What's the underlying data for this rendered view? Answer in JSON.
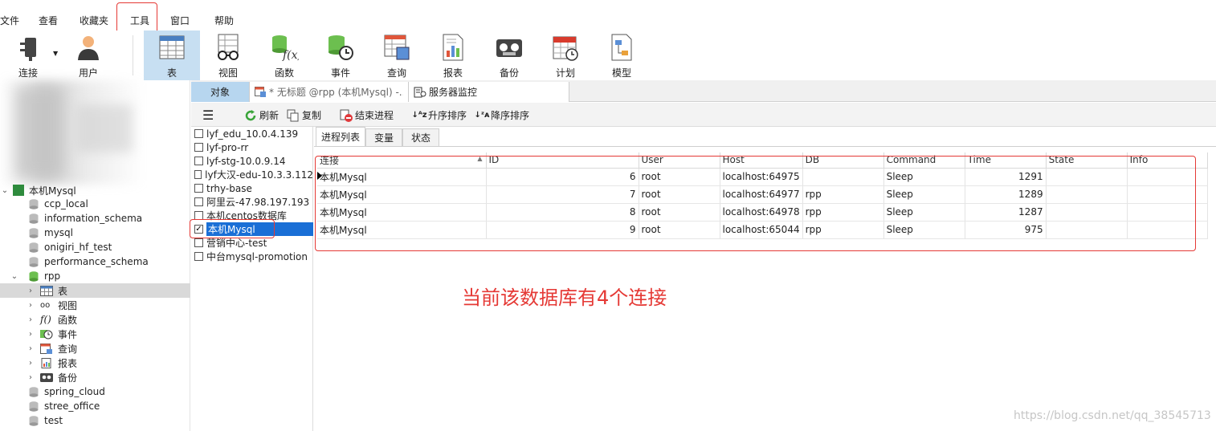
{
  "menu": {
    "items": [
      "文件",
      "查看",
      "收藏夹",
      "工具",
      "窗口",
      "帮助"
    ]
  },
  "toolbar": {
    "buttons": [
      {
        "label": "连接",
        "icon": "plug-icon"
      },
      {
        "label": "用户",
        "icon": "user-icon"
      },
      {
        "label": "表",
        "icon": "table-icon",
        "active": true
      },
      {
        "label": "视图",
        "icon": "view-glasses-icon"
      },
      {
        "label": "函数",
        "icon": "function-icon"
      },
      {
        "label": "事件",
        "icon": "event-clock-icon"
      },
      {
        "label": "查询",
        "icon": "query-icon"
      },
      {
        "label": "报表",
        "icon": "report-icon"
      },
      {
        "label": "备份",
        "icon": "backup-tape-icon"
      },
      {
        "label": "计划",
        "icon": "schedule-calendar-icon"
      },
      {
        "label": "模型",
        "icon": "model-icon"
      }
    ]
  },
  "nav": {
    "connection": "本机Mysql",
    "databases": [
      "ccp_local",
      "information_schema",
      "mysql",
      "onigiri_hf_test",
      "performance_schema"
    ],
    "open_db": "rpp",
    "rpp_children": [
      "表",
      "视图",
      "函数",
      "事件",
      "查询",
      "报表",
      "备份"
    ],
    "databases_after": [
      "spring_cloud",
      "stree_office",
      "test"
    ]
  },
  "tabs": {
    "objects": "对象",
    "query": "* 无标题 @rpp (本机Mysql) -...",
    "monitor": "服务器监控"
  },
  "actions": {
    "refresh": "刷新",
    "copy": "复制",
    "kill": "结束进程",
    "sort_asc": "升序排序",
    "sort_desc": "降序排序"
  },
  "servers": [
    {
      "name": "lyf_edu_10.0.4.139",
      "checked": false
    },
    {
      "name": "lyf-pro-rr",
      "checked": false
    },
    {
      "name": "lyf-stg-10.0.9.14",
      "checked": false
    },
    {
      "name": "lyf大汉-edu-10.3.3.112",
      "checked": false
    },
    {
      "name": "trhy-base",
      "checked": false
    },
    {
      "name": "阿里云-47.98.197.193",
      "checked": false
    },
    {
      "name": "本机centos数据库",
      "checked": false
    },
    {
      "name": "本机Mysql",
      "checked": true
    },
    {
      "name": "营销中心-test",
      "checked": false
    },
    {
      "name": "中台mysql-promotion",
      "checked": false
    }
  ],
  "panel_tabs": [
    "进程列表",
    "变量",
    "状态"
  ],
  "process_table": {
    "headers": [
      "连接",
      "ID",
      "User",
      "Host",
      "DB",
      "Command",
      "Time",
      "State",
      "Info"
    ],
    "rows": [
      [
        "本机Mysql",
        "6",
        "root",
        "localhost:64975",
        "",
        "Sleep",
        "1291",
        "",
        ""
      ],
      [
        "本机Mysql",
        "7",
        "root",
        "localhost:64977",
        "rpp",
        "Sleep",
        "1289",
        "",
        ""
      ],
      [
        "本机Mysql",
        "8",
        "root",
        "localhost:64978",
        "rpp",
        "Sleep",
        "1287",
        "",
        ""
      ],
      [
        "本机Mysql",
        "9",
        "root",
        "localhost:65044",
        "rpp",
        "Sleep",
        "975",
        "",
        ""
      ]
    ]
  },
  "annotation": "当前该数据库有4个连接",
  "watermark": "https://blog.csdn.net/qq_38545713",
  "colors": {
    "highlight": "#e53935",
    "selected": "#1a6fd6",
    "active_tool": "#c7dff2"
  }
}
